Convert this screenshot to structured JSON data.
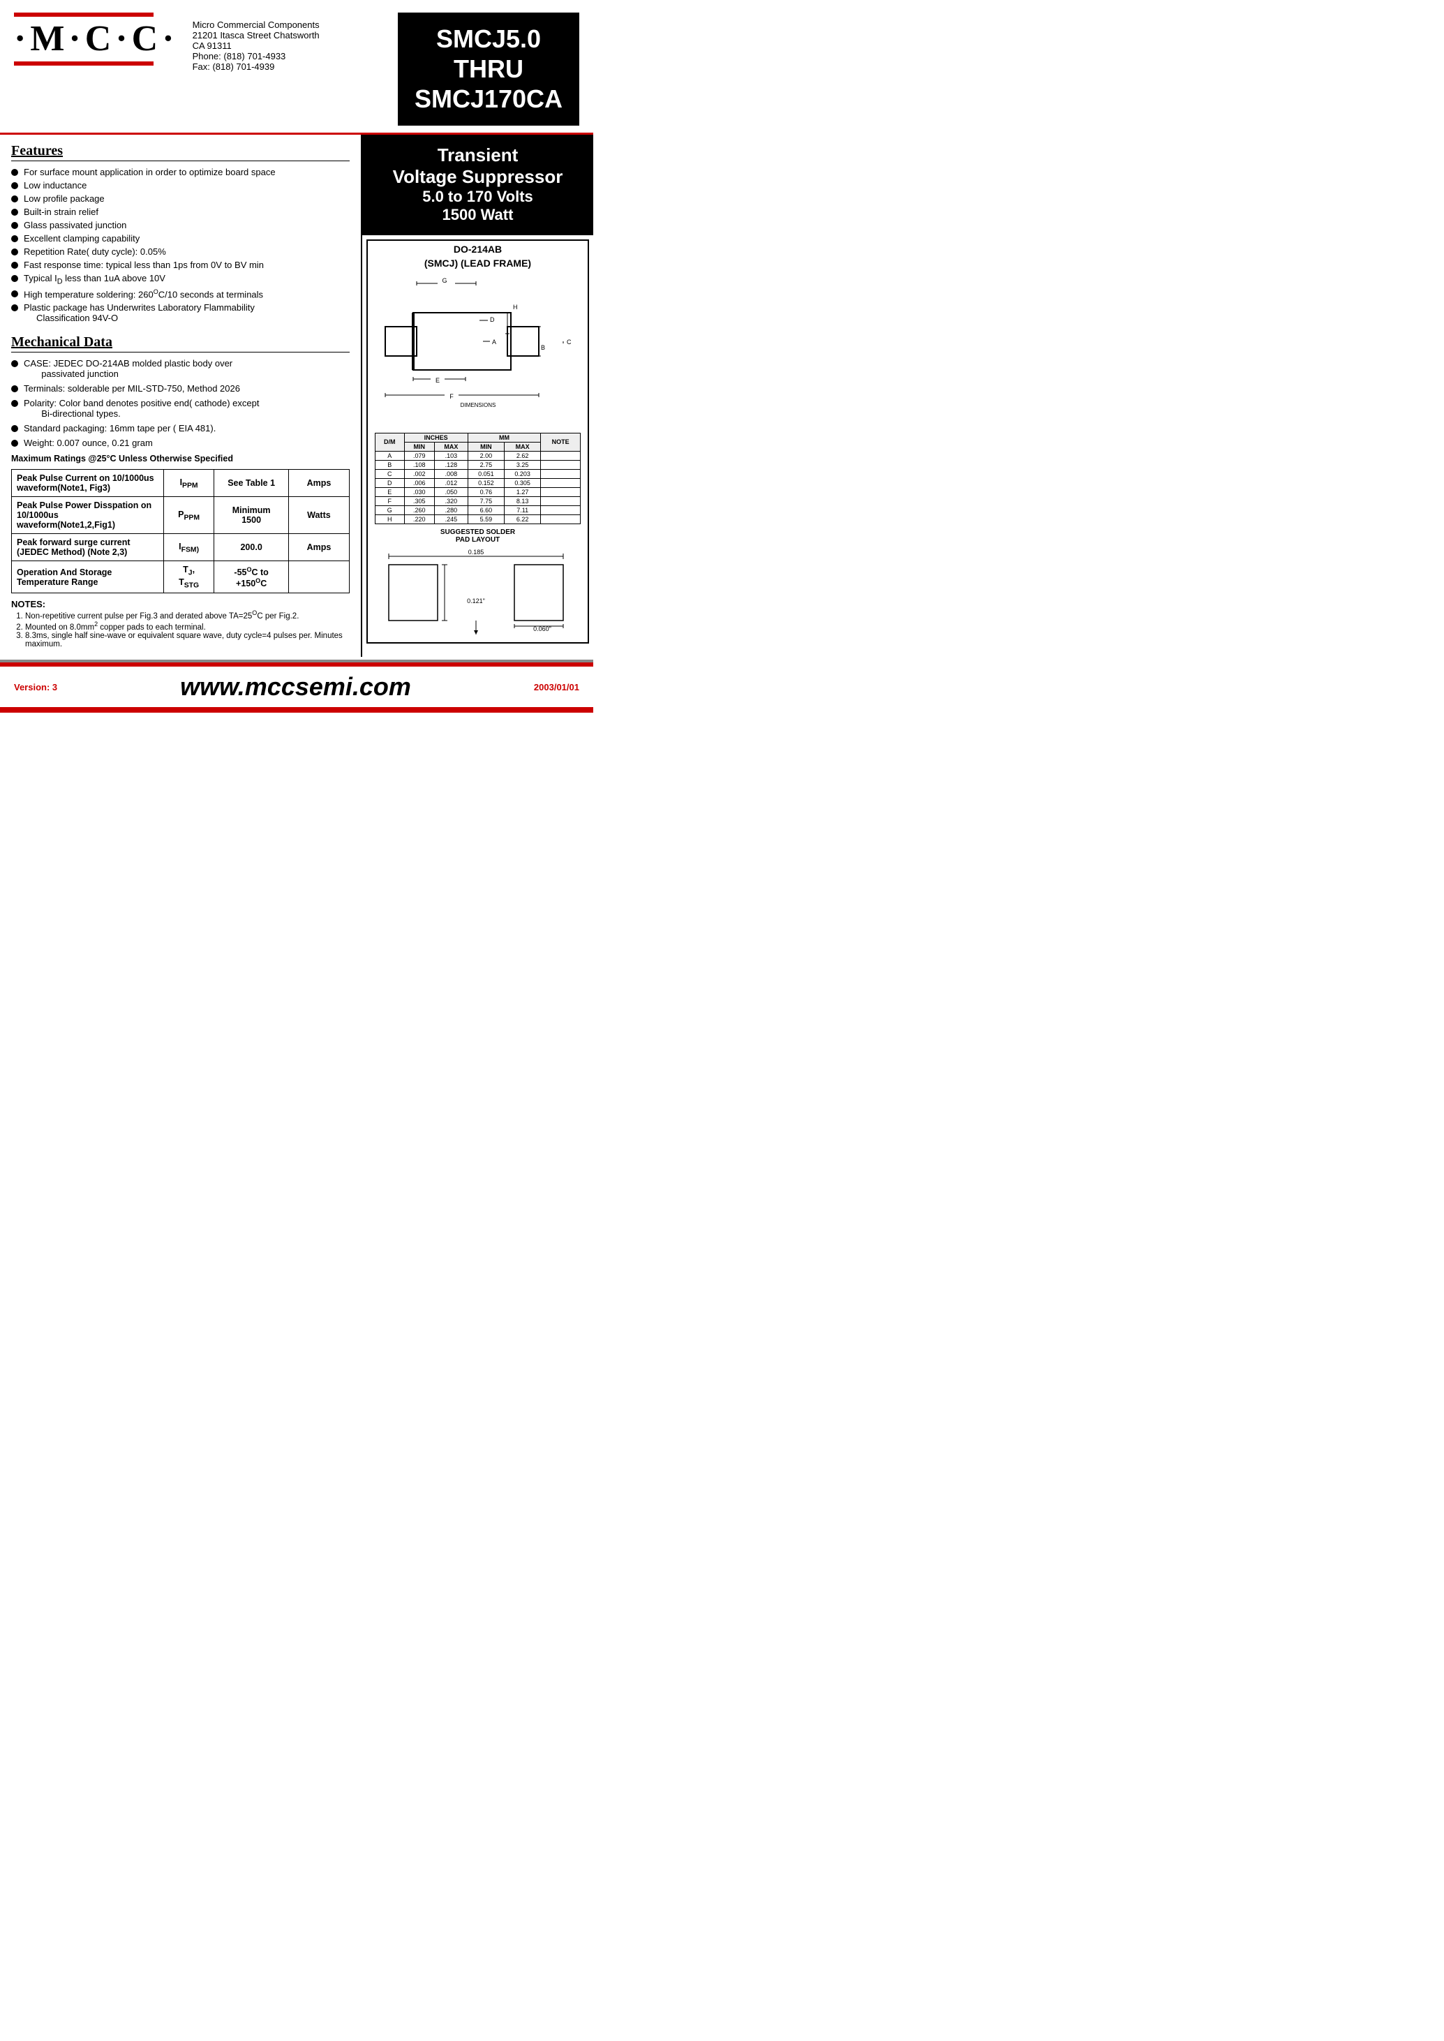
{
  "header": {
    "logo_text": "·M·C·C·",
    "company_name": "Micro Commercial Components",
    "address_line1": "21201 Itasca Street Chatsworth",
    "address_line2": "CA 91311",
    "phone": "Phone: (818) 701-4933",
    "fax": "Fax:    (818) 701-4939",
    "part_number": "SMCJ5.0\nTHRU\nSMCJ170CA"
  },
  "tvs": {
    "line1": "Transient",
    "line2": "Voltage Suppressor",
    "line3": "5.0 to 170 Volts",
    "line4": "1500 Watt"
  },
  "package": {
    "title_line1": "DO-214AB",
    "title_line2": "(SMCJ) (LEAD FRAME)"
  },
  "features": {
    "title": "Features",
    "items": [
      "For surface mount application in order to optimize board space",
      "Low inductance",
      "Low profile package",
      "Built-in strain relief",
      "Glass passivated junction",
      "Excellent clamping capability",
      "Repetition Rate( duty cycle): 0.05%",
      "Fast response time: typical less than 1ps from 0V to BV min",
      "Typical I₀ less than 1uA above 10V",
      "High temperature soldering: 260°C/10 seconds at terminals",
      "Plastic package has Underwrites Laboratory Flammability Classification 94V-O"
    ]
  },
  "mechanical": {
    "title": "Mechanical Data",
    "items": [
      "CASE: JEDEC DO-214AB molded plastic body over passivated junction",
      "Terminals:  solderable per MIL-STD-750, Method 2026",
      "Polarity: Color band denotes positive end( cathode) except Bi-directional types.",
      "Standard packaging: 16mm tape per ( EIA 481).",
      "Weight: 0.007 ounce, 0.21 gram"
    ]
  },
  "max_ratings_note": "Maximum Ratings @25°C Unless Otherwise Specified",
  "ratings_table": {
    "rows": [
      {
        "col1": "Peak Pulse Current on 10/1000us waveform(Note1, Fig3)",
        "col2": "Iₚₚₘ",
        "col3": "See Table 1",
        "col4": "Amps"
      },
      {
        "col1": "Peak Pulse Power Disspation on 10/1000us waveform(Note1,2,Fig1)",
        "col2": "Pₚₚₘ",
        "col3": "Minimum 1500",
        "col4": "Watts"
      },
      {
        "col1": "Peak forward surge current (JEDEC Method) (Note 2,3)",
        "col2": "Iⰼₛₘ⧸",
        "col3": "200.0",
        "col4": "Amps"
      },
      {
        "col1": "Operation And Storage Temperature Range",
        "col2": "Tⰼ, Tₛₜᴳ",
        "col3": "-55°C to +150°C",
        "col4": ""
      }
    ]
  },
  "notes": {
    "title": "NOTES:",
    "items": [
      "Non-repetitive current pulse per Fig.3 and derated above TA=25°C per Fig.2.",
      "Mounted on 8.0mm² copper pads to each terminal.",
      "8.3ms, single half sine-wave or equivalent square wave, duty cycle=4 pulses per. Minutes maximum."
    ]
  },
  "dimensions_table": {
    "headers": [
      "D/M",
      "MIN",
      "MAX",
      "MIN",
      "MAX",
      "NOTE"
    ],
    "sub_headers": [
      "INCHES",
      "",
      "MM",
      "",
      ""
    ],
    "rows": [
      [
        "A",
        ".079",
        ".103",
        "2.00",
        "2.62",
        ""
      ],
      [
        "B",
        ".108",
        ".128",
        "2.75",
        "3.25",
        ""
      ],
      [
        "C",
        ".002",
        ".008",
        "0.051",
        "0.203",
        ""
      ],
      [
        "D",
        ".006",
        ".012",
        "0.152",
        "0.305",
        ""
      ],
      [
        "E",
        ".030",
        ".050",
        "0.76",
        "1.27",
        ""
      ],
      [
        "F",
        ".305",
        ".320",
        "7.75",
        "8.13",
        ""
      ],
      [
        "G",
        ".260",
        ".280",
        "6.60",
        "7.11",
        ""
      ],
      [
        "H",
        ".220",
        ".245",
        "5.59",
        "6.22",
        ""
      ]
    ]
  },
  "solder": {
    "title": "SUGGESTED SOLDER PAD LAYOUT",
    "dim1": "0.185",
    "dim2": "0.121\"",
    "dim3": "0.060\""
  },
  "footer": {
    "url": "www.mccsemi.com",
    "version": "Version: 3",
    "date": "2003/01/01"
  }
}
